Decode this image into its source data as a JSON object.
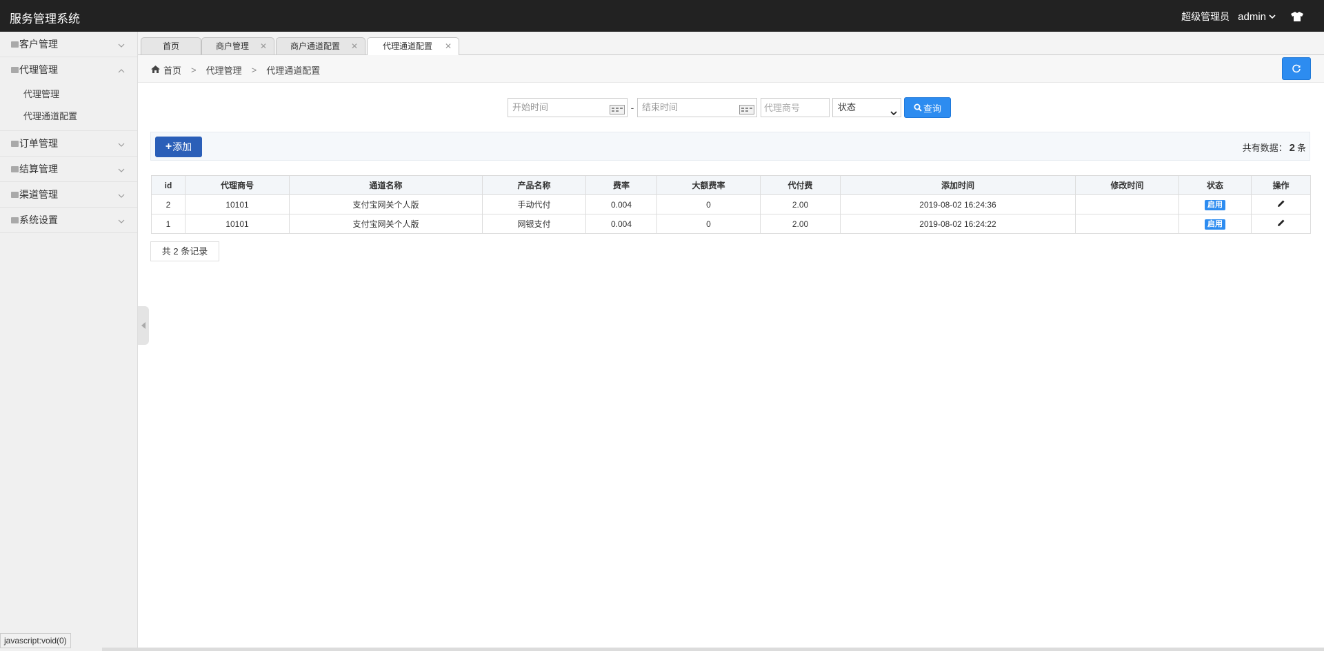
{
  "app": {
    "title": "服务管理系统",
    "role": "超级管理员",
    "username": "admin"
  },
  "sidebar": {
    "groups": [
      {
        "label": "客户管理"
      },
      {
        "label": "代理管理",
        "items": [
          "代理管理",
          "代理通道配置"
        ]
      },
      {
        "label": "订单管理"
      },
      {
        "label": "结算管理"
      },
      {
        "label": "渠道管理"
      },
      {
        "label": "系统设置"
      }
    ]
  },
  "tabs": [
    "首页",
    "商户管理",
    "商户通道配置",
    "代理通道配置"
  ],
  "breadcrumb": [
    "首页",
    "代理管理",
    "代理通道配置"
  ],
  "breadcrumb_sep": ">",
  "search": {
    "start_placeholder": "开始时间",
    "end_placeholder": "结束时间",
    "range_dash": "-",
    "agent_placeholder": "代理商号",
    "status_value": "状态",
    "query_label": "查询"
  },
  "toolbar": {
    "add_label": "添加",
    "total_prefix": "共有数据：",
    "total_count": "2",
    "total_suffix": "条"
  },
  "table": {
    "headers": [
      "id",
      "代理商号",
      "通道名称",
      "产品名称",
      "费率",
      "大额费率",
      "代付费",
      "添加时间",
      "修改时间",
      "状态",
      "操作"
    ],
    "rows": [
      {
        "id": "2",
        "agent": "10101",
        "channel": "支付宝网关个人版",
        "product": "手动代付",
        "rate": "0.004",
        "big_rate": "0",
        "fee": "2.00",
        "added": "2019-08-02 16:24:36",
        "modified": "",
        "status": "启用"
      },
      {
        "id": "1",
        "agent": "10101",
        "channel": "支付宝网关个人版",
        "product": "网银支付",
        "rate": "0.004",
        "big_rate": "0",
        "fee": "2.00",
        "added": "2019-08-02 16:24:22",
        "modified": "",
        "status": "启用"
      }
    ]
  },
  "pager": {
    "text": "共 2 条记录"
  },
  "statusbar": {
    "text": "javascript:void(0)"
  },
  "colors": {
    "header_bg": "#222222",
    "primary": "#2d8cf0",
    "add_button": "#2b5fb8"
  },
  "icons": [
    "shirt-icon",
    "chevron-down-icon",
    "chevron-up-icon",
    "home-icon",
    "refresh-icon",
    "calendar-icon",
    "search-icon",
    "plus-icon",
    "edit-icon",
    "close-icon",
    "collapse-left-icon"
  ]
}
